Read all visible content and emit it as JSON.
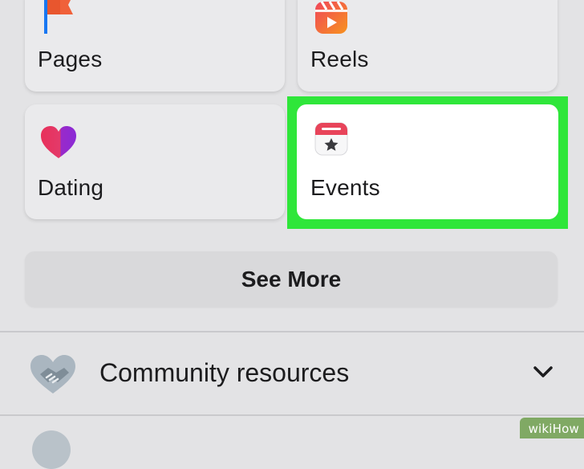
{
  "shortcuts": {
    "pages": {
      "label": "Pages",
      "icon": "pages-flag-icon"
    },
    "reels": {
      "label": "Reels",
      "icon": "reels-icon"
    },
    "dating": {
      "label": "Dating",
      "icon": "heart-icon"
    },
    "events": {
      "label": "Events",
      "icon": "calendar-star-icon",
      "highlighted": true,
      "highlight_color": "#2fe63a"
    }
  },
  "see_more": {
    "label": "See More"
  },
  "community_resources": {
    "label": "Community resources",
    "icon": "handshake-heart-icon",
    "expand_icon": "chevron-down-icon"
  },
  "watermark": {
    "text": "wikiHow"
  },
  "colors": {
    "background": "#e3e3e5",
    "tile": "#eaeaec",
    "highlight": "#2fe63a",
    "events_accent": "#e8445a"
  }
}
